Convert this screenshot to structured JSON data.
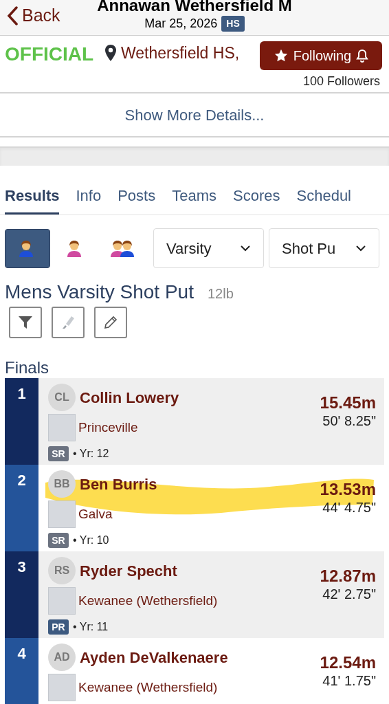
{
  "header": {
    "back": "Back",
    "title": "Annawan Wethersfield M",
    "date": "Mar 25, 2026",
    "level_badge": "HS"
  },
  "meet": {
    "status": "OFFICIAL",
    "location": "Wethersfield HS,",
    "follow_button": {
      "label": "Following",
      "following": true
    },
    "followers": "100 Followers"
  },
  "show_more": "Show More Details...",
  "tabs": [
    {
      "label": "Results",
      "selected": true
    },
    {
      "label": "Info",
      "selected": false
    },
    {
      "label": "Posts",
      "selected": false
    },
    {
      "label": "Teams",
      "selected": false
    },
    {
      "label": "Scores",
      "selected": false
    },
    {
      "label": "Schedul",
      "selected": false
    }
  ],
  "gender_filters": [
    {
      "kind": "male",
      "selected": true
    },
    {
      "kind": "female",
      "selected": false
    },
    {
      "kind": "mixed",
      "selected": false
    }
  ],
  "dropdowns": [
    {
      "value": "Varsity"
    },
    {
      "value": "Shot Pu"
    }
  ],
  "event": {
    "title": "Mens Varsity Shot Put",
    "weight": "12lb"
  },
  "section": "Finals",
  "results": [
    {
      "rank": "1",
      "initials": "CL",
      "name": "Collin Lowery",
      "team": "Princeville",
      "class": {
        "label": "SR",
        "color": "#6b7280"
      },
      "year": "• Yr: 12",
      "metric": "15.45m",
      "imperial": "50' 8.25\"",
      "highlighted": false
    },
    {
      "rank": "2",
      "initials": "BB",
      "name": "Ben Burris",
      "team": "Galva",
      "class": {
        "label": "SR",
        "color": "#6b7280"
      },
      "year": "• Yr: 10",
      "metric": "13.53m",
      "imperial": "44' 4.75\"",
      "highlighted": true
    },
    {
      "rank": "3",
      "initials": "RS",
      "name": "Ryder Specht",
      "team": "Kewanee (Wethersfield)",
      "class": {
        "label": "PR",
        "color": "#3d5a80"
      },
      "year": "• Yr: 11",
      "metric": "12.87m",
      "imperial": "42' 2.75\"",
      "highlighted": false
    },
    {
      "rank": "4",
      "initials": "AD",
      "name": "Ayden DeValkenaere",
      "team": "Kewanee (Wethersfield)",
      "metric": "12.54m",
      "imperial": "41' 1.75\"",
      "highlighted": false
    }
  ]
}
